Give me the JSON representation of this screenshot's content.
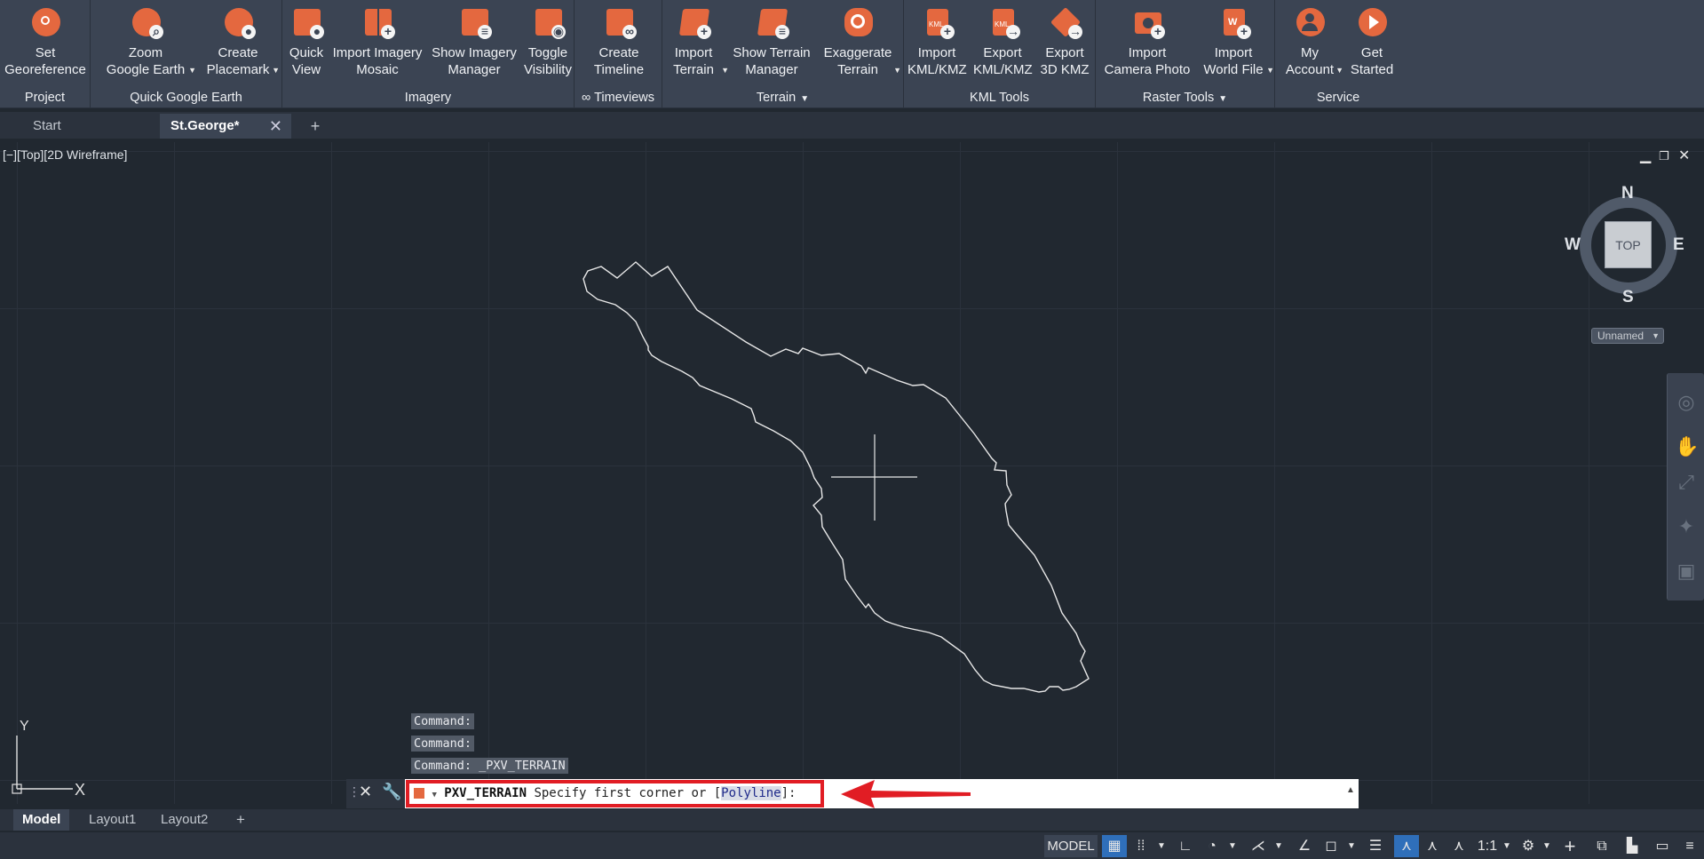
{
  "ribbon": {
    "groups": [
      {
        "title": "Project",
        "buttons": [
          {
            "label1": "Set",
            "label2": "Georeference"
          }
        ]
      },
      {
        "title": "Quick Google Earth",
        "buttons": [
          {
            "label1": "Zoom",
            "label2": "Google Earth"
          },
          {
            "label1": "Create",
            "label2": "Placemark"
          }
        ]
      },
      {
        "title": "Imagery",
        "buttons": [
          {
            "label1": "Quick",
            "label2": "View"
          },
          {
            "label1": "Import Imagery",
            "label2": "Mosaic"
          },
          {
            "label1": "Show Imagery",
            "label2": "Manager"
          },
          {
            "label1": "Toggle",
            "label2": "Visibility"
          }
        ]
      },
      {
        "title": "∞ Timeviews",
        "buttons": [
          {
            "label1": "Create",
            "label2": "Timeline"
          }
        ]
      },
      {
        "title": "Terrain",
        "buttons": [
          {
            "label1": "Import",
            "label2": "Terrain"
          },
          {
            "label1": "Show Terrain",
            "label2": "Manager"
          },
          {
            "label1": "Exaggerate",
            "label2": "Terrain"
          }
        ]
      },
      {
        "title": "KML Tools",
        "buttons": [
          {
            "label1": "Import",
            "label2": "KML/KMZ"
          },
          {
            "label1": "Export",
            "label2": "KML/KMZ"
          },
          {
            "label1": "Export",
            "label2": "3D KMZ"
          }
        ]
      },
      {
        "title": "Raster Tools",
        "buttons": [
          {
            "label1": "Import",
            "label2": "Camera Photo"
          },
          {
            "label1": "Import",
            "label2": "World File"
          }
        ]
      },
      {
        "title": "Service",
        "buttons": [
          {
            "label1": "My",
            "label2": "Account"
          },
          {
            "label1": "Get",
            "label2": "Started"
          }
        ]
      }
    ]
  },
  "tabs": [
    {
      "label": "Start"
    },
    {
      "label": "St.George*"
    }
  ],
  "viewport": {
    "label": "[−][Top][2D Wireframe]",
    "viewcube": {
      "top": "TOP",
      "n": "N",
      "s": "S",
      "e": "E",
      "w": "W",
      "named_view": "Unnamed"
    }
  },
  "command_history": [
    "Command:",
    "Command:",
    "Command:  _PXV_TERRAIN"
  ],
  "command_line": {
    "command": "PXV_TERRAIN",
    "prompt": "Specify first corner or [",
    "option": "Polyline",
    "suffix": "]:",
    "input_value": ""
  },
  "ucs": {
    "x": "X",
    "y": "Y"
  },
  "layout_tabs": [
    {
      "label": "Model"
    },
    {
      "label": "Layout1"
    },
    {
      "label": "Layout2"
    }
  ],
  "statusbar": {
    "model": "MODEL",
    "scale": "1:1"
  },
  "colors": {
    "accent": "#e4683f",
    "ribbon_bg": "#3b4453",
    "canvas_bg": "#212830",
    "highlight_red": "#e11d24"
  }
}
